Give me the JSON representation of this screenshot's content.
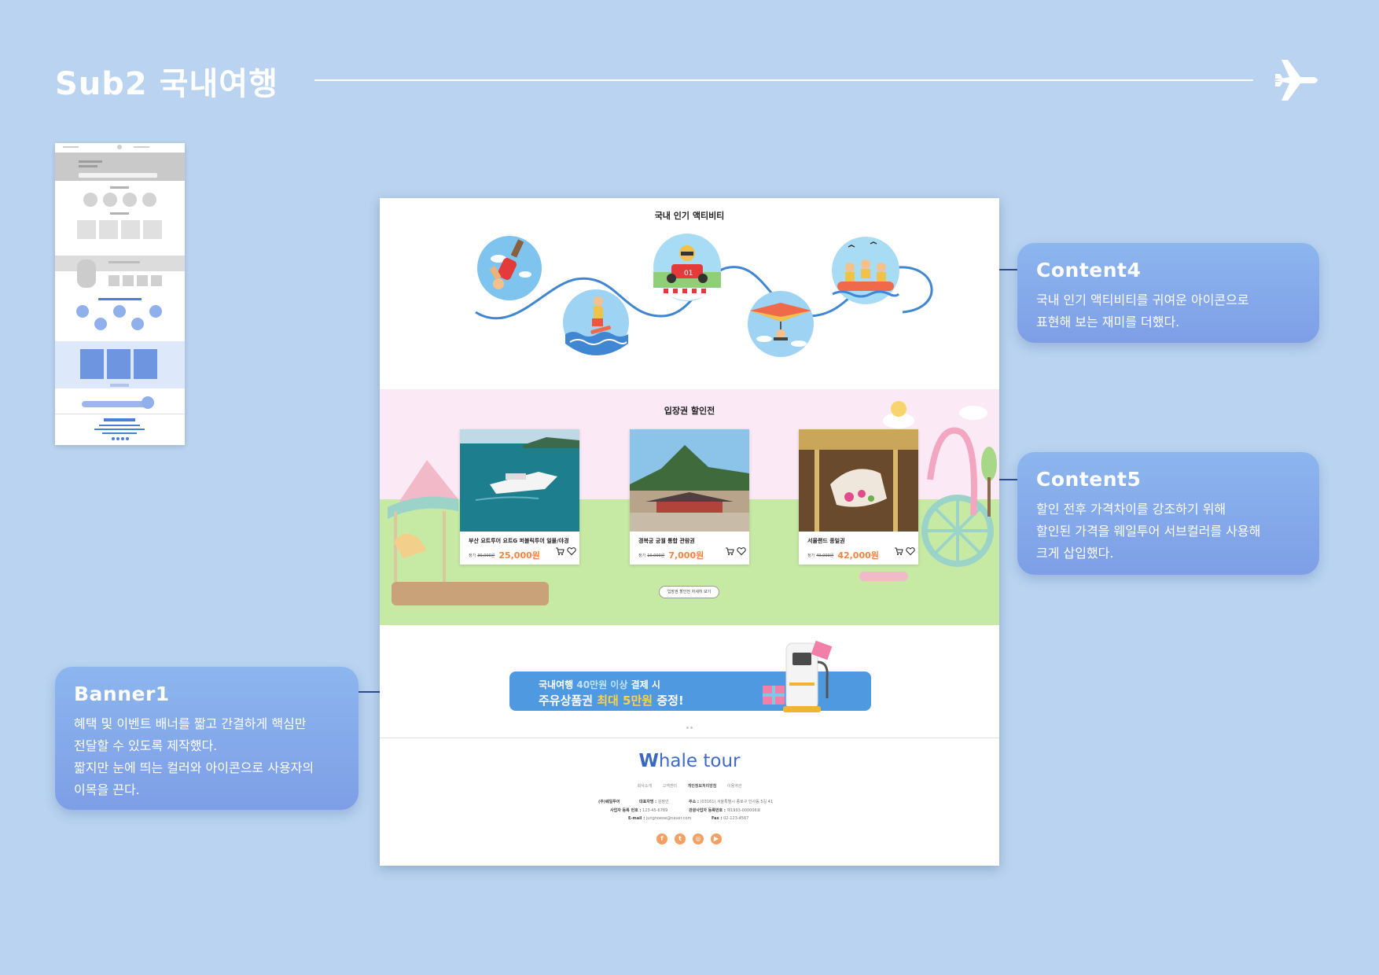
{
  "page": {
    "title": "Sub2 국내여행",
    "plane_icon": "airplane-icon"
  },
  "callouts": {
    "content4": {
      "title": "Content4",
      "lines": [
        "국내 인기 액티비티를 귀여운 아이콘으로",
        "표현해 보는 재미를 더했다."
      ]
    },
    "content5": {
      "title": "Content5",
      "lines": [
        "할인 전후 가격차이를 강조하기 위해",
        "할인된 가격을 웨일투어 서브컬러를 사용해",
        "크게 삽입했다."
      ]
    },
    "banner1": {
      "title": "Banner1",
      "lines": [
        "혜택 및 이벤트 배너를 짧고 간결하게 핵심만",
        "전달할 수 있도록 제작했다.",
        "짧지만 눈에 띄는 컬러와 아이콘으로 사용자의",
        "이목을 끈다."
      ]
    }
  },
  "mockup": {
    "activity": {
      "title": "국내 인기 액티비티",
      "icons": [
        "bungee-jump-icon",
        "surfing-icon",
        "go-kart-icon",
        "hang-glider-icon",
        "rafting-icon"
      ]
    },
    "discount": {
      "title": "입장권 할인전",
      "products": [
        {
          "name": "부산 요트투어 요트G 퍼블릭투어 일몰/야경",
          "orig_label": "정가",
          "orig_price": "30,000원",
          "sale_price": "25,000원",
          "image": "yacht-photo"
        },
        {
          "name": "경복궁 궁궐 통합 관람권",
          "orig_label": "정가",
          "orig_price": "10,000원",
          "sale_price": "7,000원",
          "image": "palace-photo"
        },
        {
          "name": "서울랜드 종일권",
          "orig_label": "정가",
          "orig_price": "49,000원",
          "sale_price": "42,000원",
          "image": "carousel-photo"
        }
      ],
      "more_button": "입장권 할인전 자세히 보기"
    },
    "banner": {
      "line1_a": "국내여행 ",
      "line1_b": "40만원 이상",
      "line1_c": " 결제 시",
      "line2_a": "주유상품권 ",
      "line2_b": "최대 5만원",
      "line2_c": " 증정!",
      "icon": "gas-pump-gift-icon"
    },
    "footer": {
      "logo_w": "W",
      "logo_rest": "hale tour",
      "links": [
        "회사소개",
        "고객센터",
        "개인정보처리방침",
        "이용약관"
      ],
      "company": "(주)웨일투어",
      "ceo_label": "대표자명 :",
      "ceo": "김정인",
      "address_label": "주소 :",
      "address": "(03161) 서울특별시 종로구 인사동 5길 41",
      "biz_label": "사업자 등록 번호 :",
      "biz_no": "123-45-6789",
      "tour_label": "관광사업자 등록번호 :",
      "tour_no": "제1993-000006호",
      "email_label": "E-mail :",
      "email": "jungnoeoe@naver.com",
      "fax_label": "Fax :",
      "fax": "02-123-4567",
      "social": [
        "facebook-icon",
        "twitter-icon",
        "instagram-icon",
        "youtube-icon"
      ]
    }
  },
  "colors": {
    "background": "#b9d3f0",
    "callout": "#86a9ea",
    "sale_price": "#f2843d",
    "banner": "#4f99e0",
    "logo": "#3e6bc7"
  }
}
